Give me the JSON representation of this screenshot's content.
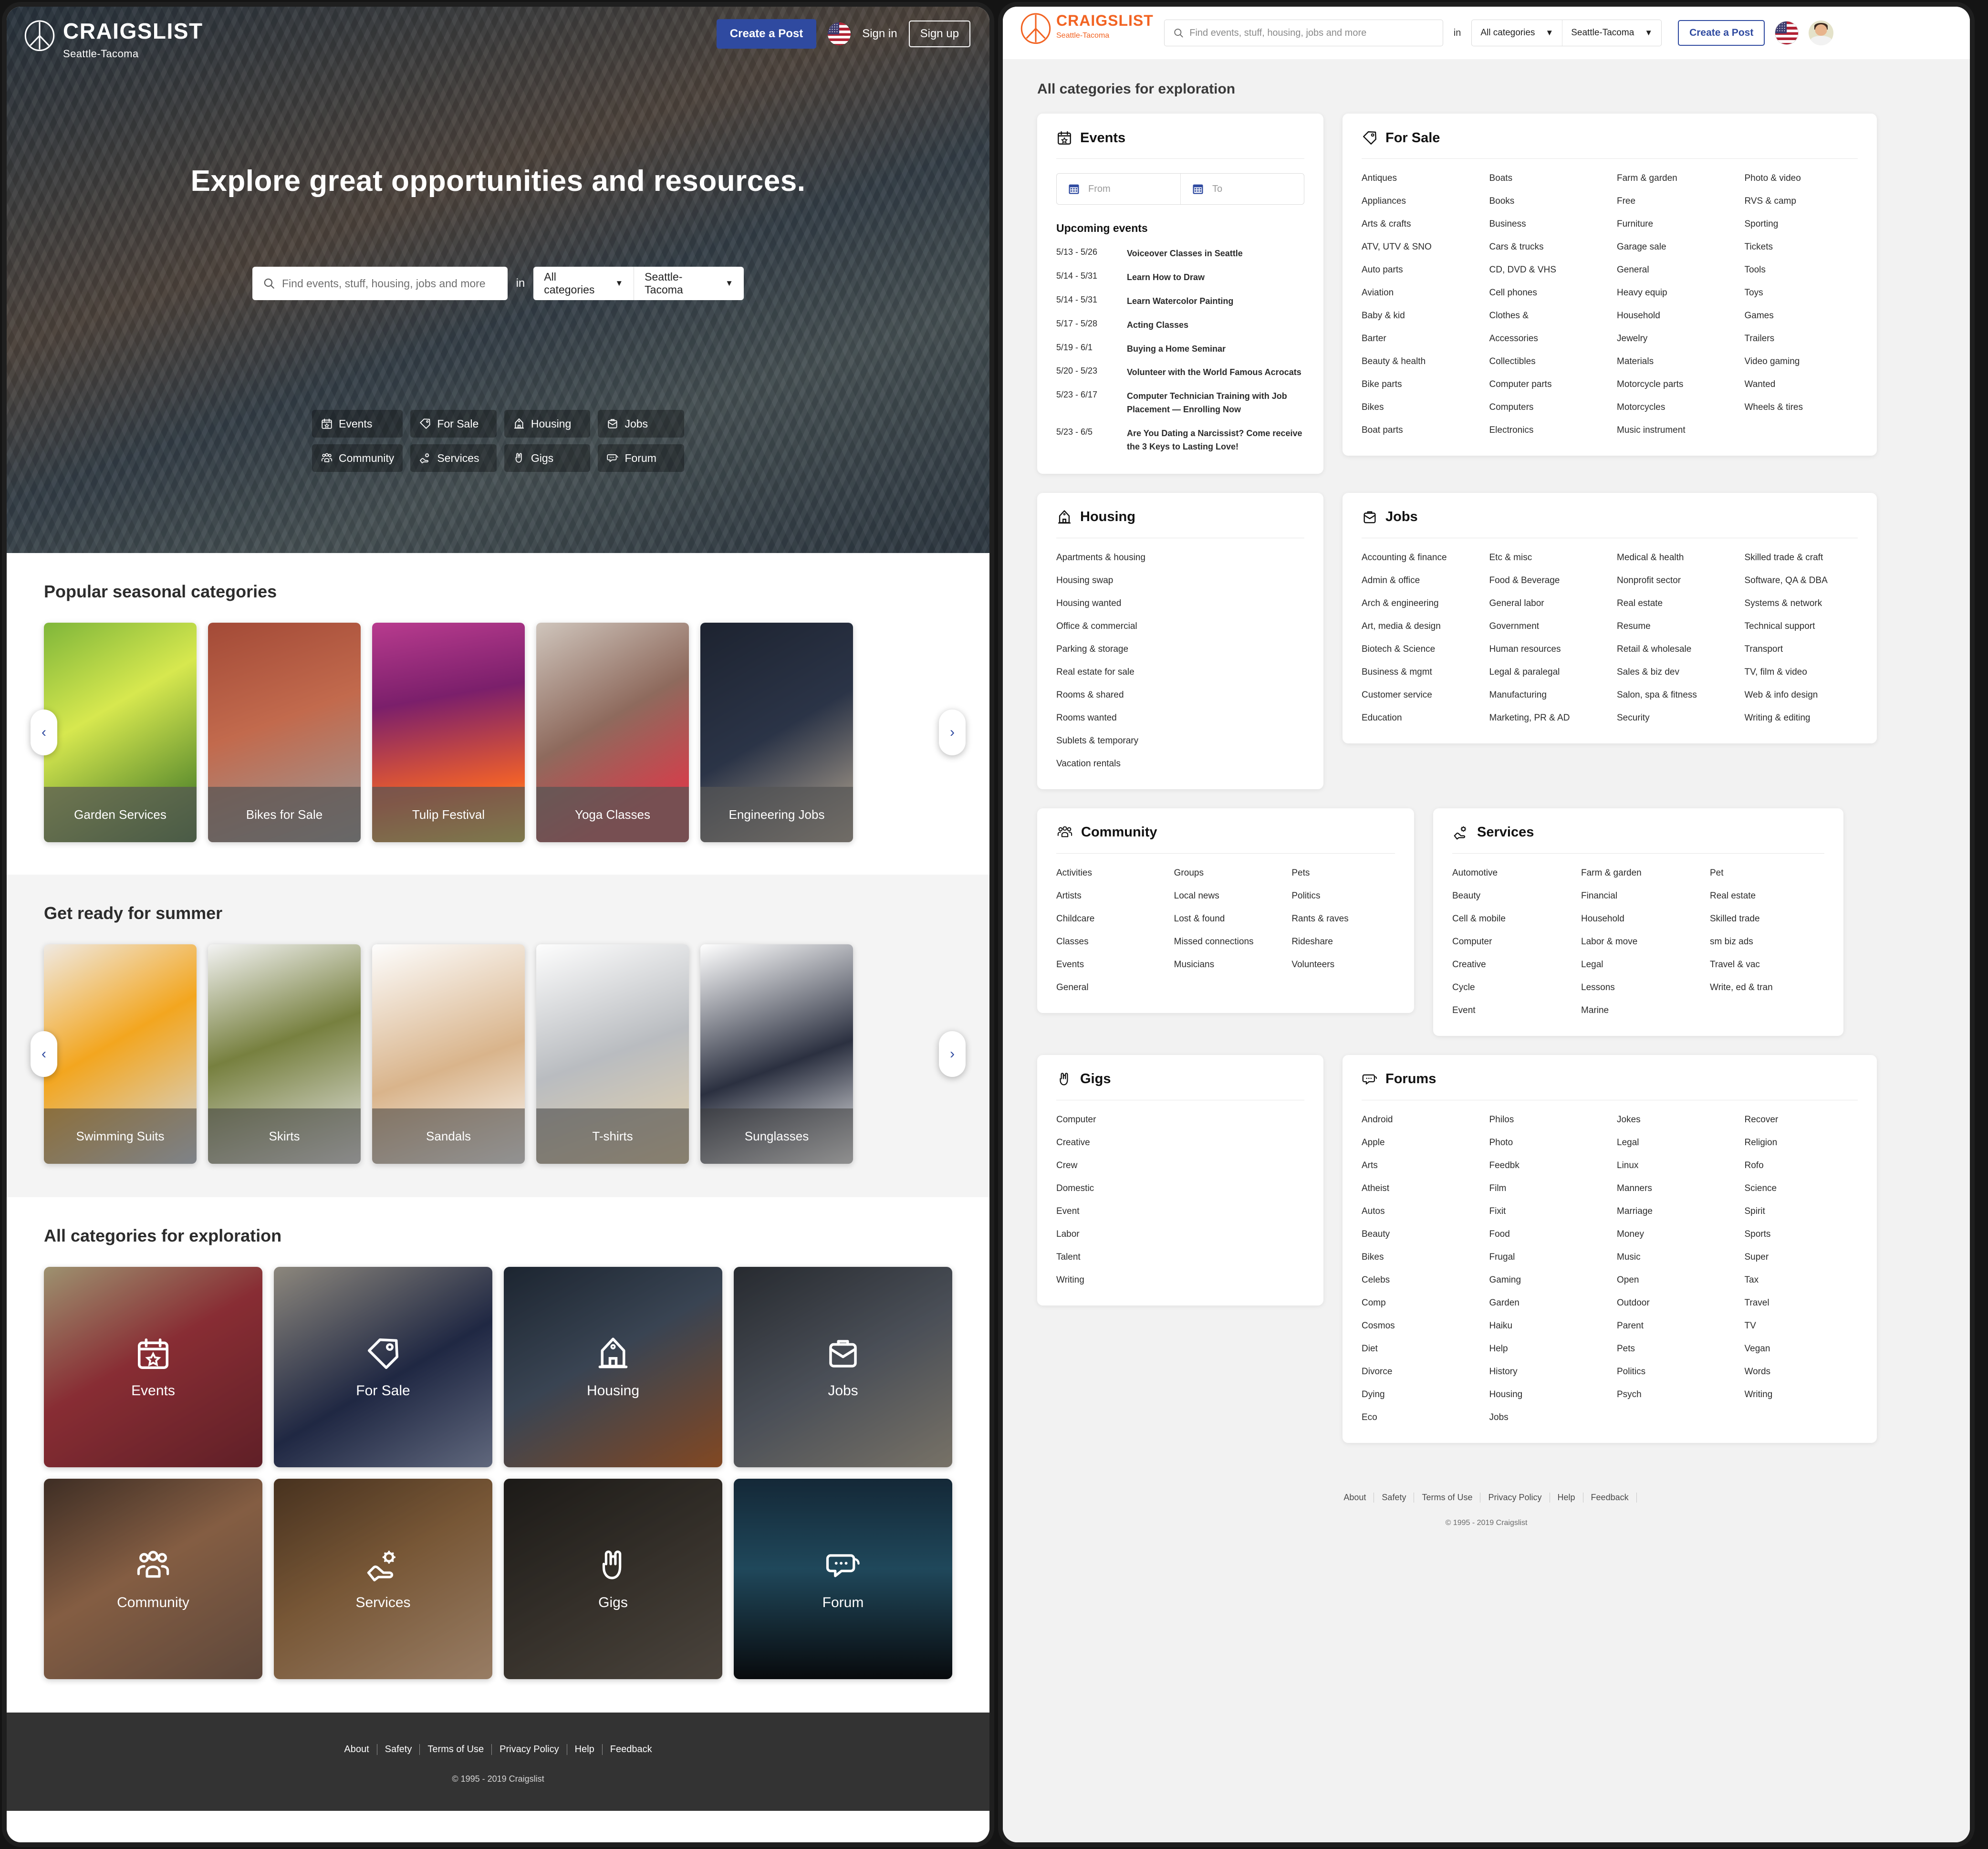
{
  "colors": {
    "accent_blue": "#2f4aa0",
    "brand_orange": "#f26322",
    "footer_dark": "#333333",
    "page_grey": "#f2f2f2"
  },
  "left": {
    "brand": {
      "name": "CRAIGSLIST",
      "sub": "Seattle-Tacoma"
    },
    "header": {
      "create_post": "Create a Post",
      "sign_in": "Sign in",
      "sign_up": "Sign up",
      "flag_icon": "us-flag-icon"
    },
    "hero": {
      "headline": "Explore great opportunities and resources.",
      "search_placeholder": "Find events, stuff, housing, jobs and more",
      "search_value": "",
      "in_label": "in",
      "category_select": "All categories",
      "location_select": "Seattle-Tacoma"
    },
    "chips": [
      {
        "label": "Events",
        "icon": "calendar-star-icon"
      },
      {
        "label": "For Sale",
        "icon": "price-tag-icon"
      },
      {
        "label": "Housing",
        "icon": "house-icon"
      },
      {
        "label": "Jobs",
        "icon": "briefcase-icon"
      },
      {
        "label": "Community",
        "icon": "people-group-icon"
      },
      {
        "label": "Services",
        "icon": "hand-gear-icon"
      },
      {
        "label": "Gigs",
        "icon": "rock-hand-icon"
      },
      {
        "label": "Forum",
        "icon": "speech-bubbles-icon"
      }
    ],
    "seasonal": {
      "title": "Popular seasonal categories",
      "prev_label": "‹",
      "next_label": "›",
      "items": [
        {
          "label": "Garden Services",
          "photo": "p-garden"
        },
        {
          "label": "Bikes for Sale",
          "photo": "p-bike"
        },
        {
          "label": "Tulip Festival",
          "photo": "p-tulip"
        },
        {
          "label": "Yoga Classes",
          "photo": "p-yoga"
        },
        {
          "label": "Engineering Jobs",
          "photo": "p-eng"
        }
      ]
    },
    "summer": {
      "title": "Get ready for summer",
      "prev_label": "‹",
      "next_label": "›",
      "items": [
        {
          "label": "Swimming Suits",
          "photo": "p-swim"
        },
        {
          "label": "Skirts",
          "photo": "p-skirt"
        },
        {
          "label": "Sandals",
          "photo": "p-sandal"
        },
        {
          "label": "T-shirts",
          "photo": "p-tshirt"
        },
        {
          "label": "Sunglasses",
          "photo": "p-sun"
        }
      ]
    },
    "all_categories": {
      "title": "All categories for exploration",
      "items": [
        {
          "label": "Events",
          "icon": "calendar-star-icon",
          "photo": "p-events"
        },
        {
          "label": "For Sale",
          "icon": "price-tag-icon",
          "photo": "p-forsale"
        },
        {
          "label": "Housing",
          "icon": "house-icon",
          "photo": "p-housing"
        },
        {
          "label": "Jobs",
          "icon": "briefcase-icon",
          "photo": "p-jobs"
        },
        {
          "label": "Community",
          "icon": "people-group-icon",
          "photo": "p-comm"
        },
        {
          "label": "Services",
          "icon": "hand-gear-icon",
          "photo": "p-serv"
        },
        {
          "label": "Gigs",
          "icon": "rock-hand-icon",
          "photo": "p-gigs"
        },
        {
          "label": "Forum",
          "icon": "speech-bubbles-icon",
          "photo": "p-forum"
        }
      ]
    },
    "footer": {
      "links": [
        "About",
        "Safety",
        "Terms of Use",
        "Privacy Policy",
        "Help",
        "Feedback"
      ],
      "copyright": "© 1995 - 2019 Craigslist"
    }
  },
  "right": {
    "brand": {
      "name": "CRAIGSLIST",
      "sub": "Seattle-Tacoma"
    },
    "header": {
      "search_placeholder": "Find events, stuff, housing, jobs and more",
      "search_value": "",
      "in_label": "in",
      "category_select": "All categories",
      "location_select": "Seattle-Tacoma",
      "create_post": "Create a Post",
      "flag_icon": "us-flag-icon",
      "avatar_icon": "user-avatar"
    },
    "page_title": "All categories for exploration",
    "events": {
      "title": "Events",
      "icon": "calendar-star-icon",
      "from_placeholder": "From",
      "to_placeholder": "To",
      "upcoming_title": "Upcoming events",
      "items": [
        {
          "date": "5/13 - 5/26",
          "name": "Voiceover Classes in Seattle"
        },
        {
          "date": "5/14 - 5/31",
          "name": "Learn How to Draw"
        },
        {
          "date": "5/14 - 5/31",
          "name": "Learn Watercolor Painting"
        },
        {
          "date": "5/17 - 5/28",
          "name": "Acting Classes"
        },
        {
          "date": "5/19 - 6/1",
          "name": "Buying a Home Seminar"
        },
        {
          "date": "5/20 - 5/23",
          "name": "Volunteer with the World Famous Acrocats"
        },
        {
          "date": "5/23 - 6/17",
          "name": "Computer Technician Training with Job Placement — Enrolling Now"
        },
        {
          "date": "5/23 - 6/5",
          "name": "Are You Dating a Narcissist? Come receive the 3 Keys to Lasting Love!"
        }
      ]
    },
    "for_sale": {
      "title": "For Sale",
      "icon": "price-tag-icon",
      "columns": [
        [
          "Antiques",
          "Appliances",
          "Arts & crafts",
          "ATV, UTV & SNO",
          "Auto parts",
          "Aviation",
          "Baby & kid",
          "Barter",
          "Beauty & health",
          "Bike parts",
          "Bikes",
          "Boat parts"
        ],
        [
          "Boats",
          "Books",
          "Business",
          "Cars & trucks",
          "CD, DVD & VHS",
          "Cell phones",
          "Clothes &",
          "Accessories",
          "Collectibles",
          "Computer parts",
          "Computers",
          "Electronics"
        ],
        [
          "Farm & garden",
          "Free",
          "Furniture",
          "Garage sale",
          "General",
          "Heavy equip",
          "Household",
          "Jewelry",
          "Materials",
          "Motorcycle parts",
          "Motorcycles",
          "Music instrument"
        ],
        [
          "Photo & video",
          "RVS & camp",
          "Sporting",
          "Tickets",
          "Tools",
          "Toys",
          "Games",
          "Trailers",
          "Video gaming",
          "Wanted",
          "Wheels & tires"
        ]
      ]
    },
    "housing": {
      "title": "Housing",
      "icon": "house-icon",
      "columns": [
        [
          "Apartments & housing",
          "Housing swap",
          "Housing wanted",
          "Office & commercial",
          "Parking & storage",
          "Real estate for sale",
          "Rooms & shared",
          "Rooms wanted",
          "Sublets & temporary",
          "Vacation rentals"
        ]
      ]
    },
    "jobs": {
      "title": "Jobs",
      "icon": "briefcase-icon",
      "columns": [
        [
          "Accounting & finance",
          "Admin & office",
          "Arch & engineering",
          "Art, media & design",
          "Biotech & Science",
          "Business & mgmt",
          "Customer service",
          "Education"
        ],
        [
          "Etc & misc",
          "Food & Beverage",
          "General labor",
          "Government",
          "Human resources",
          "Legal & paralegal",
          "Manufacturing",
          "Marketing, PR & AD"
        ],
        [
          "Medical & health",
          "Nonprofit sector",
          "Real estate",
          "Resume",
          "Retail & wholesale",
          "Sales & biz dev",
          "Salon, spa & fitness",
          "Security"
        ],
        [
          "Skilled trade & craft",
          "Software, QA & DBA",
          "Systems & network",
          "Technical support",
          "Transport",
          "TV, film & video",
          "Web & info design",
          "Writing & editing"
        ]
      ]
    },
    "community": {
      "title": "Community",
      "icon": "people-group-icon",
      "columns": [
        [
          "Activities",
          "Artists",
          "Childcare",
          "Classes",
          "Events",
          "General"
        ],
        [
          "Groups",
          "Local news",
          "Lost & found",
          "Missed connections",
          "Musicians"
        ],
        [
          "Pets",
          "Politics",
          "Rants & raves",
          "Rideshare",
          "Volunteers"
        ]
      ]
    },
    "services": {
      "title": "Services",
      "icon": "hand-gear-icon",
      "columns": [
        [
          "Automotive",
          "Beauty",
          "Cell & mobile",
          "Computer",
          "Creative",
          "Cycle",
          "Event"
        ],
        [
          "Farm & garden",
          "Financial",
          "Household",
          "Labor & move",
          "Legal",
          "Lessons",
          "Marine"
        ],
        [
          "Pet",
          "Real estate",
          "Skilled trade",
          "sm biz ads",
          "Travel & vac",
          "Write, ed & tran"
        ]
      ]
    },
    "gigs": {
      "title": "Gigs",
      "icon": "rock-hand-icon",
      "columns": [
        [
          "Computer",
          "Creative",
          "Crew",
          "Domestic",
          "Event",
          "Labor",
          "Talent",
          "Writing"
        ]
      ]
    },
    "forums": {
      "title": "Forums",
      "icon": "speech-bubbles-icon",
      "columns": [
        [
          "Android",
          "Apple",
          "Arts",
          "Atheist",
          "Autos",
          "Beauty",
          "Bikes",
          "Celebs",
          "Comp",
          "Cosmos",
          "Diet",
          "Divorce",
          "Dying",
          "Eco"
        ],
        [
          "Philos",
          "Photo",
          "Feedbk",
          "Film",
          "Fixit",
          "Food",
          "Frugal",
          "Gaming",
          "Garden",
          "Haiku",
          "Help",
          "History",
          "Housing",
          "Jobs"
        ],
        [
          "Jokes",
          "Legal",
          "Linux",
          "Manners",
          "Marriage",
          "Money",
          "Music",
          "Open",
          "Outdoor",
          "Parent",
          "Pets",
          "Politics",
          "Psych"
        ],
        [
          "Recover",
          "Religion",
          "Rofo",
          "Science",
          "Spirit",
          "Sports",
          "Super",
          "Tax",
          "Travel",
          "TV",
          "Vegan",
          "Words",
          "Writing"
        ]
      ]
    },
    "footer": {
      "links": [
        "About",
        "Safety",
        "Terms of Use",
        "Privacy Policy",
        "Help",
        "Feedback"
      ],
      "copyright": "© 1995 - 2019 Craigslist"
    }
  }
}
